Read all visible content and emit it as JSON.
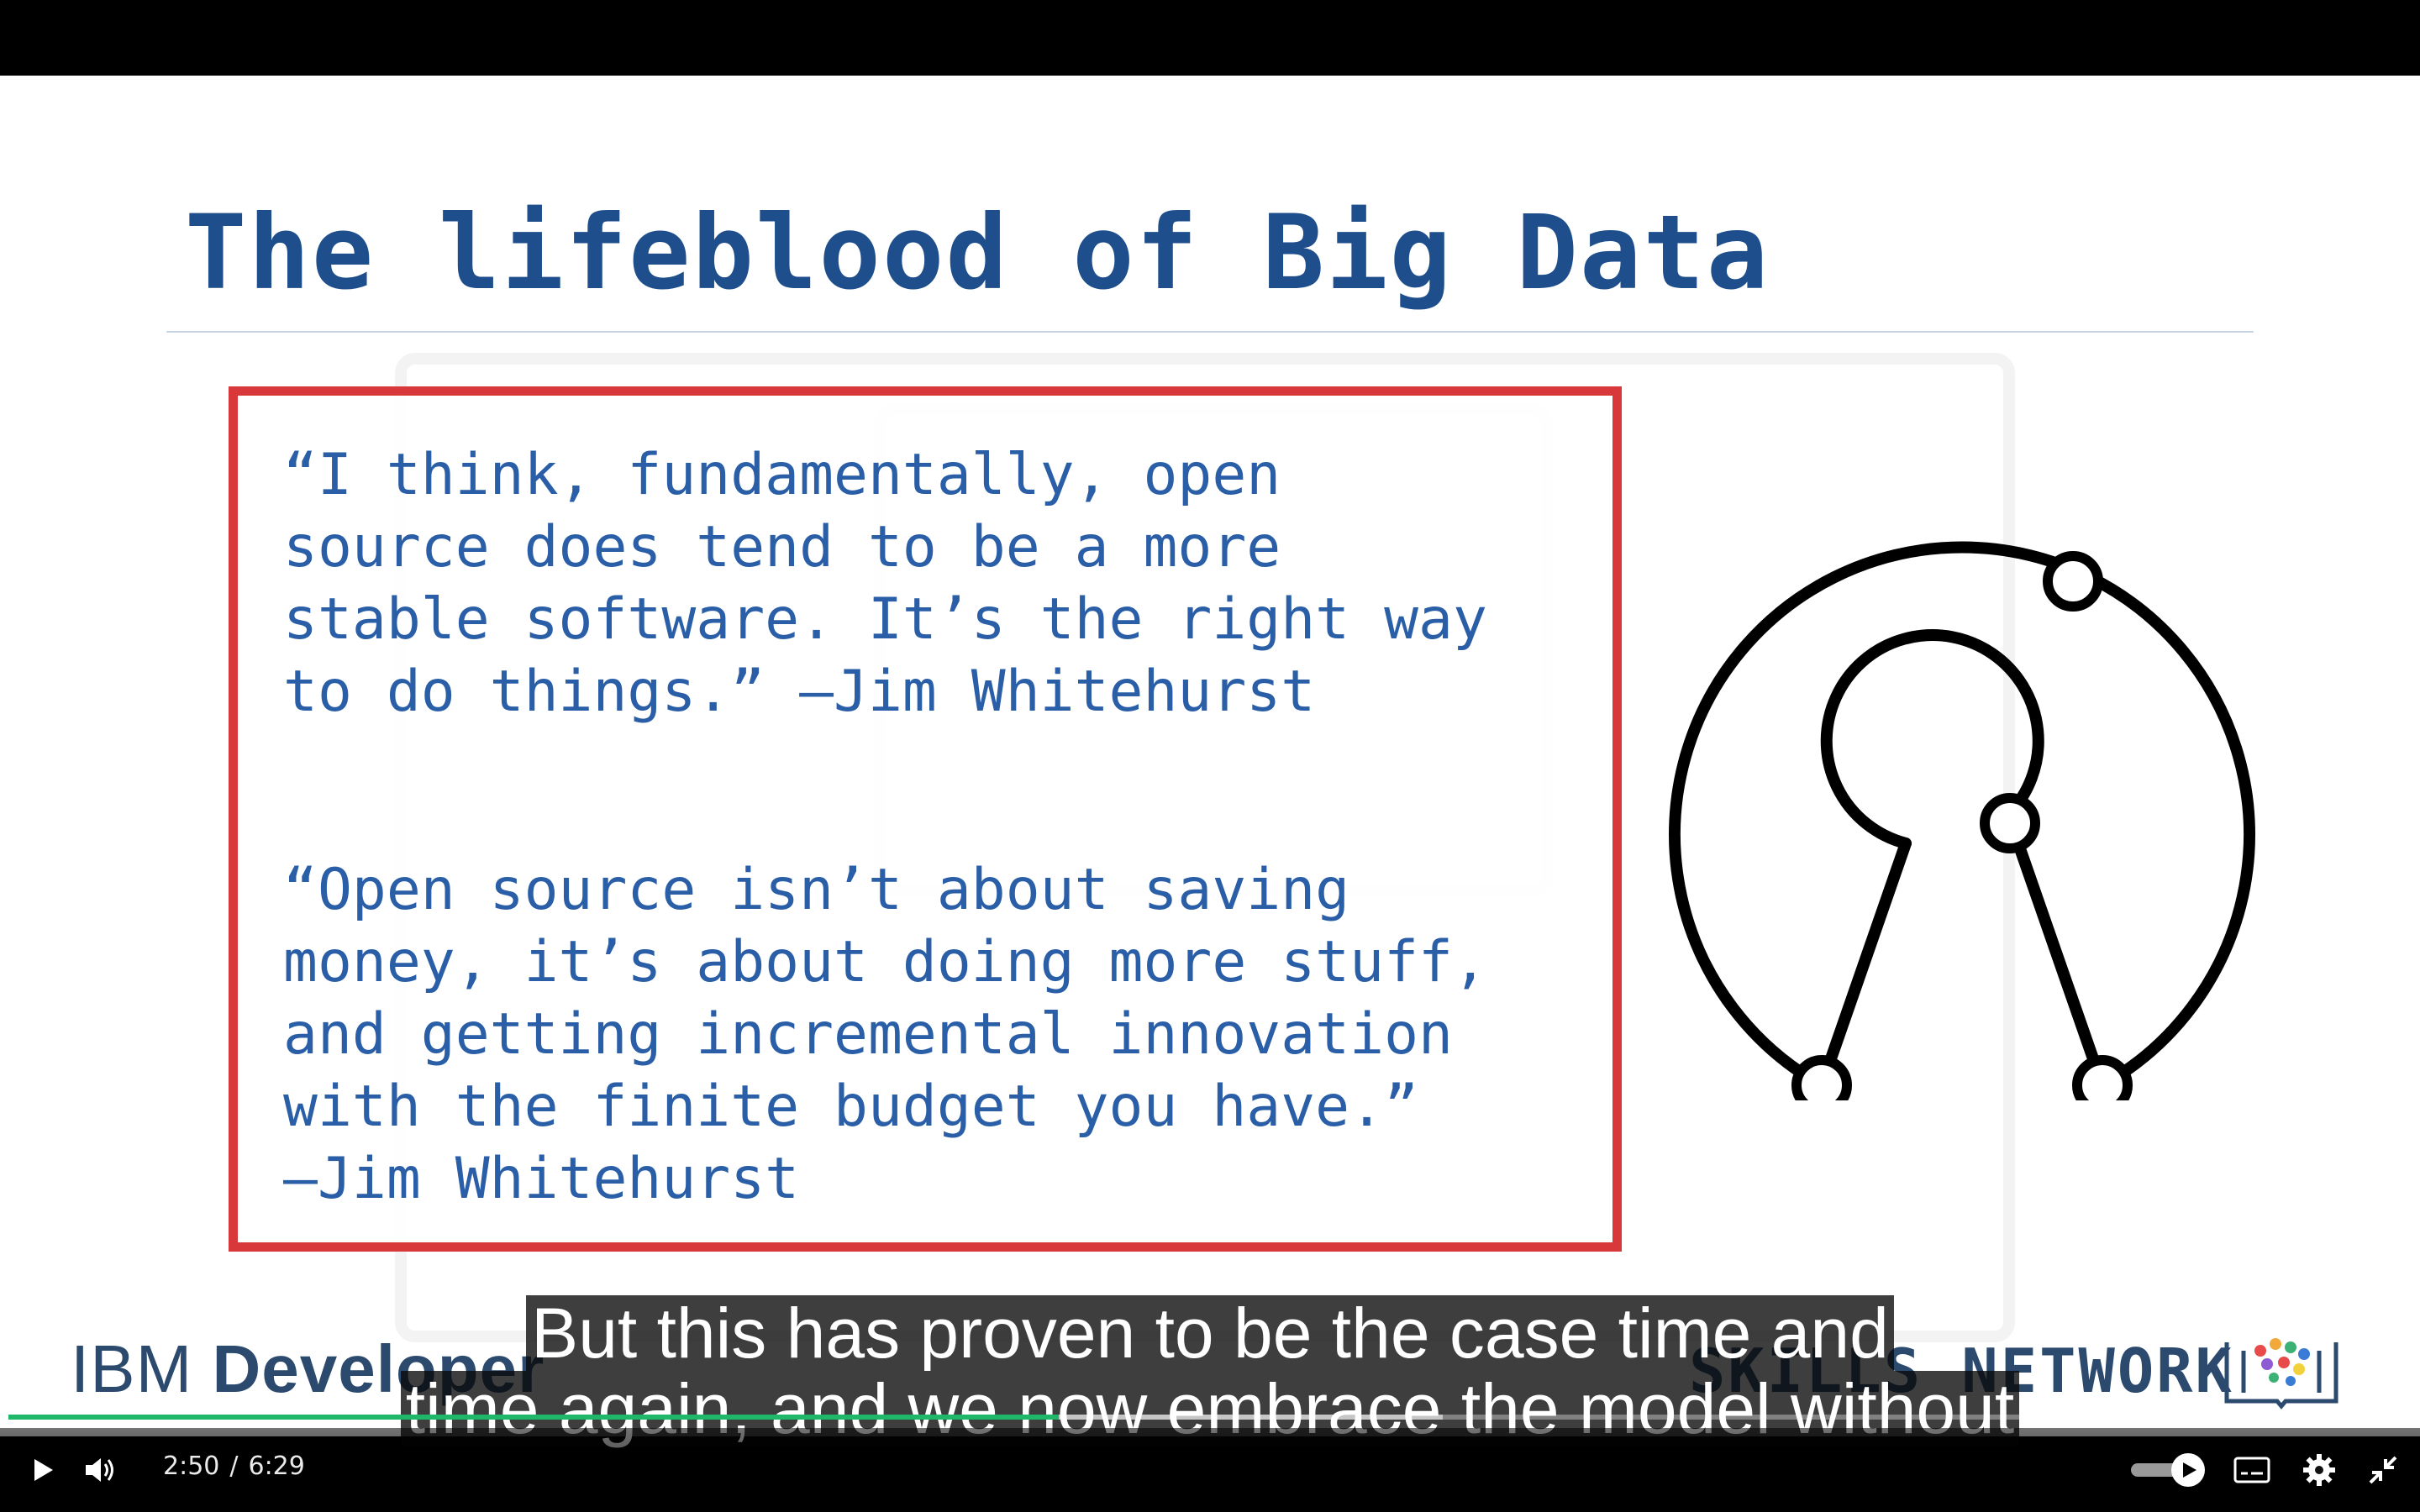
{
  "slide": {
    "title": "The lifeblood of Big Data",
    "quote1": "“I think, fundamentally, open\nsource does tend to be a more\nstable software. It’s the right way\nto do things.” —Jim Whitehurst",
    "quote2": "“Open source isn’t about saving\nmoney, it’s about doing more stuff,\nand getting incremental innovation\nwith the finite budget you have.”\n—Jim Whitehurst",
    "brand_left_regular": "IBM ",
    "brand_left_bold": "Developer",
    "brand_right": "SKILLS NETWORK"
  },
  "captions": {
    "line1": "But this has proven to be the case time and",
    "line2": "time again, and we now embrace the model without"
  },
  "player": {
    "current_time": "2:50",
    "separator": "/",
    "duration": "6:29",
    "progress_fraction": 0.437,
    "buffered_fraction": 0.16,
    "accent_color": "#1fb86a"
  },
  "icons": {
    "play": "play-icon",
    "volume": "volume-icon",
    "captions_toggle": "toggle-icon",
    "subtitles": "subtitles-icon",
    "settings": "gear-icon",
    "exit_fullscreen": "exit-fullscreen-icon"
  }
}
